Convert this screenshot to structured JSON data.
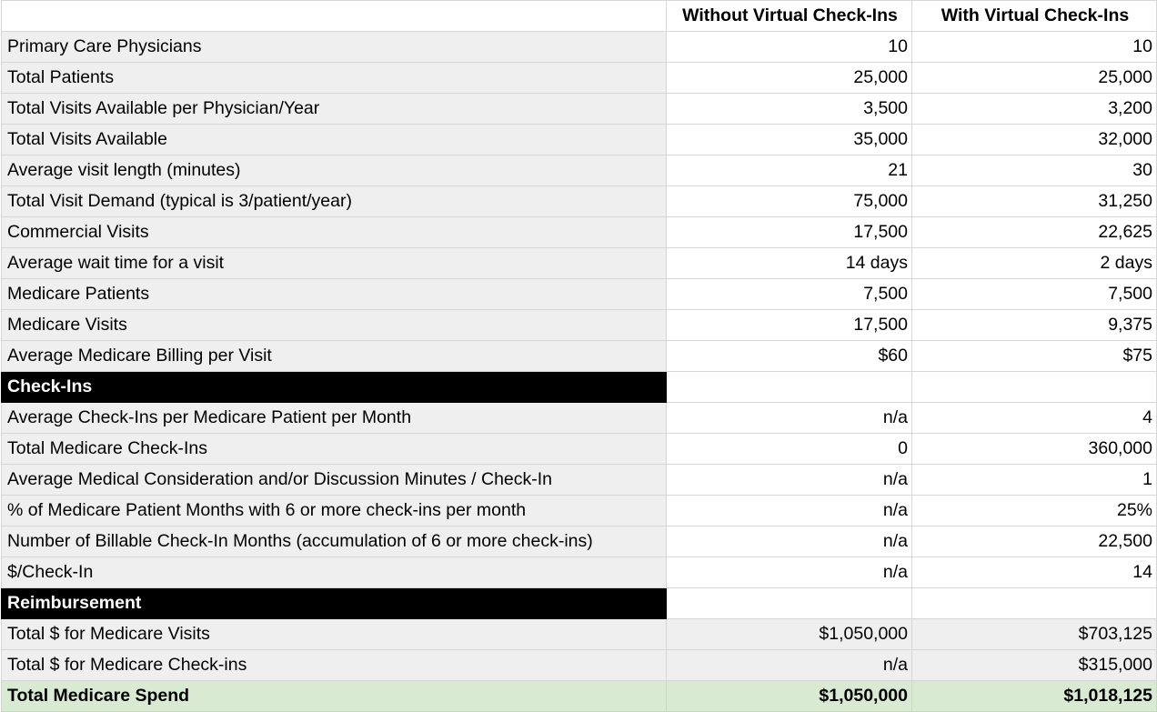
{
  "header": {
    "corner": "",
    "col_a": "Without Virtual Check-Ins",
    "col_b": "With Virtual Check-Ins"
  },
  "rows": [
    {
      "label": "Primary Care Physicians",
      "a": "10",
      "b": "10"
    },
    {
      "label": "Total Patients",
      "a": "25,000",
      "b": "25,000"
    },
    {
      "label": "Total Visits Available per Physician/Year",
      "a": "3,500",
      "b": "3,200"
    },
    {
      "label": "Total Visits Available",
      "a": "35,000",
      "b": "32,000"
    },
    {
      "label": "Average visit length (minutes)",
      "a": "21",
      "b": "30"
    },
    {
      "label": "Total Visit Demand (typical is 3/patient/year)",
      "a": "75,000",
      "b": "31,250"
    },
    {
      "label": "Commercial Visits",
      "a": "17,500",
      "b": "22,625"
    },
    {
      "label": "Average wait time for a visit",
      "a": "14 days",
      "b": "2 days"
    },
    {
      "label": "Medicare Patients",
      "a": "7,500",
      "b": "7,500"
    },
    {
      "label": "Medicare Visits",
      "a": "17,500",
      "b": "9,375"
    },
    {
      "label": "Average Medicare Billing per Visit",
      "a": "$60",
      "b": "$75"
    }
  ],
  "checkins": {
    "title": "Check-Ins",
    "rows": [
      {
        "label": "Average Check-Ins per Medicare Patient per Month",
        "a": "n/a",
        "b": "4"
      },
      {
        "label": "Total Medicare Check-Ins",
        "a": "0",
        "b": "360,000"
      },
      {
        "label": "Average Medical Consideration and/or Discussion Minutes / Check-In",
        "a": "n/a",
        "b": "1"
      },
      {
        "label": "% of Medicare Patient Months with 6 or more check-ins per month",
        "a": "n/a",
        "b": "25%"
      },
      {
        "label": "Number of Billable Check-In Months (accumulation of 6 or more check-ins)",
        "a": "n/a",
        "b": "22,500"
      },
      {
        "label": "$/Check-In",
        "a": "n/a",
        "b": "14"
      }
    ]
  },
  "reimbursement": {
    "title": "Reimbursement",
    "rows": [
      {
        "label": "Total $ for Medicare Visits",
        "a": "$1,050,000",
        "b": "$703,125"
      },
      {
        "label": "Total $ for Medicare Check-ins",
        "a": "n/a",
        "b": "$315,000"
      }
    ]
  },
  "total": {
    "label": "Total Medicare Spend",
    "a": "$1,050,000",
    "b": "$1,018,125"
  },
  "colors": {
    "label_bg": "#efefef",
    "section_bg": "#000000",
    "total_bg": "#d9ead3",
    "gridline": "#d6d6d6"
  }
}
